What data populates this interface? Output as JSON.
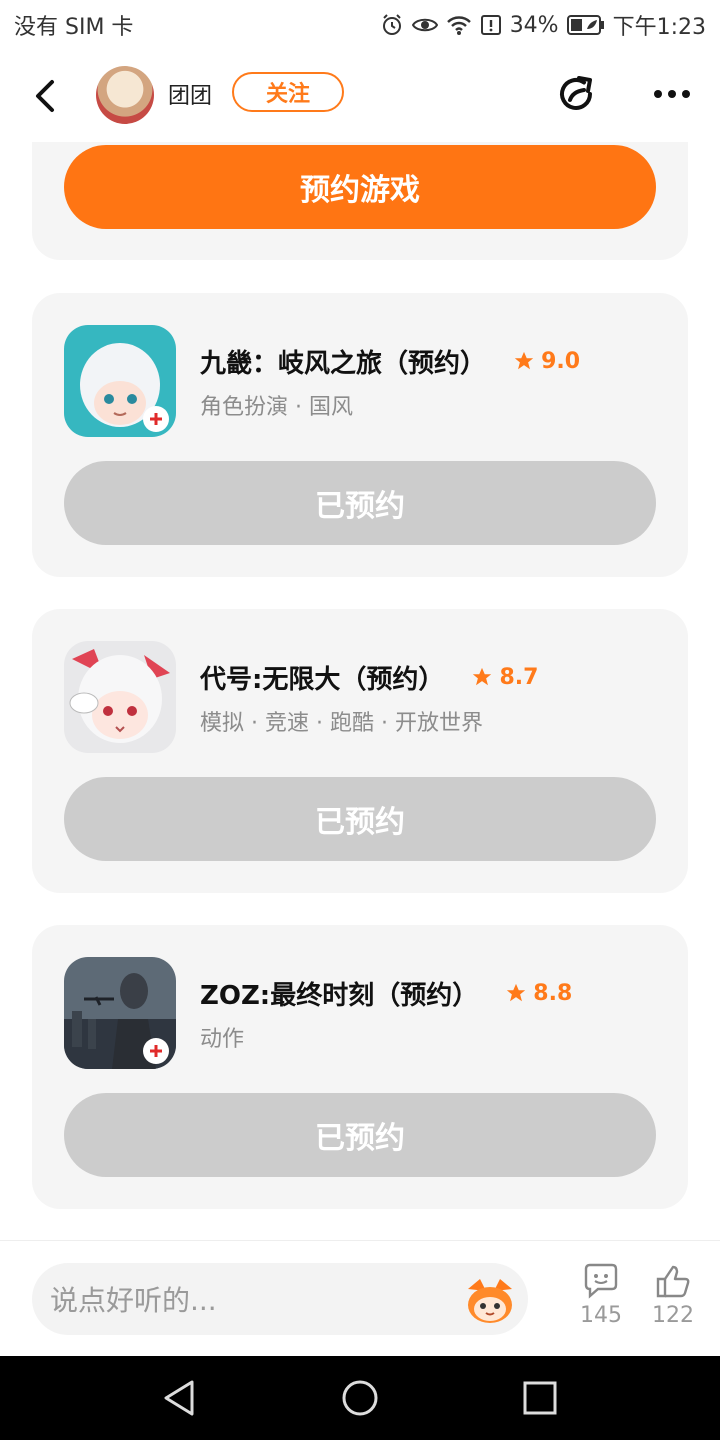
{
  "status_bar": {
    "carrier": "没有 SIM 卡",
    "battery": "34%",
    "time": "下午1:23"
  },
  "header": {
    "username": "团团",
    "follow_label": "关注"
  },
  "top_button": "预约游戏",
  "games": [
    {
      "title": "九畿：岐风之旅（预约）",
      "rating": "9.0",
      "tags": "角色扮演 · 国风",
      "button": "已预约"
    },
    {
      "title": "代号:无限大（预约）",
      "rating": "8.7",
      "tags": "模拟 · 竞速 · 跑酷 · 开放世界",
      "button": "已预约"
    },
    {
      "title": "ZOZ:最终时刻（预约）",
      "rating": "8.8",
      "tags": "动作",
      "button": "已预约"
    }
  ],
  "bottom": {
    "comment_placeholder": "说点好听的...",
    "comments_count": "145",
    "likes_count": "122"
  },
  "colors": {
    "accent": "#ff7513",
    "disabled": "#cccccc",
    "card_bg": "#f5f5f5"
  },
  "icons": [
    "alarm-icon",
    "eye-icon",
    "wifi-icon",
    "battery-saver-icon",
    "battery-icon",
    "back-arrow-icon",
    "share-icon",
    "more-icon",
    "star-icon",
    "mascot-icon",
    "comment-icon",
    "like-icon",
    "nav-back-icon",
    "nav-home-icon",
    "nav-recent-icon"
  ]
}
